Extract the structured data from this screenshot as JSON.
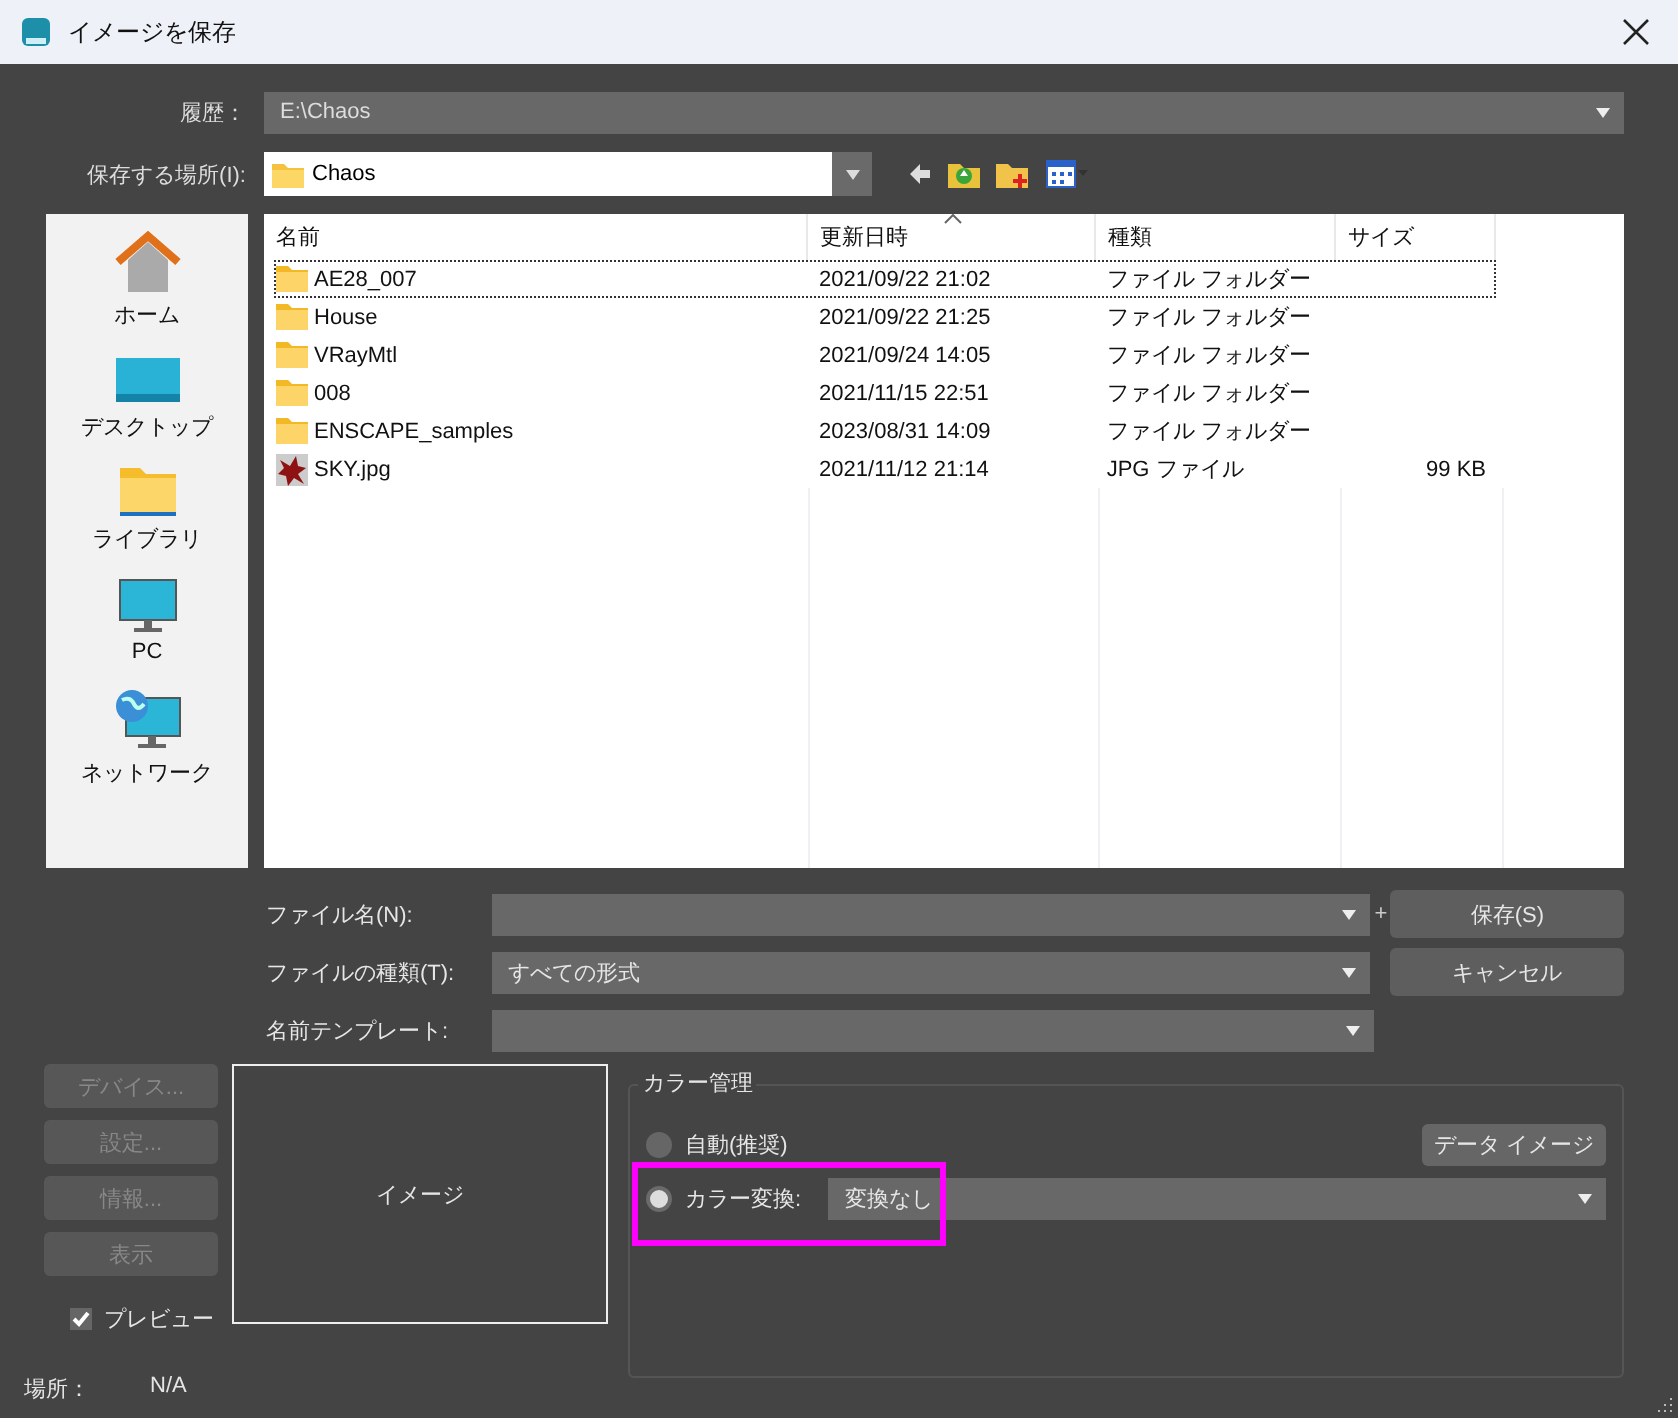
{
  "window": {
    "title": "イメージを保存"
  },
  "history": {
    "label": "履歴：",
    "value": "E:\\Chaos"
  },
  "save_in": {
    "label": "保存する場所(I):",
    "value": "Chaos"
  },
  "places": [
    {
      "label": "ホーム",
      "kind": "home"
    },
    {
      "label": "デスクトップ",
      "kind": "desktop"
    },
    {
      "label": "ライブラリ",
      "kind": "library"
    },
    {
      "label": "PC",
      "kind": "pc"
    },
    {
      "label": "ネットワーク",
      "kind": "network"
    }
  ],
  "file_list": {
    "columns": [
      {
        "label": "名前",
        "sorted": false
      },
      {
        "label": "更新日時",
        "sorted": true
      },
      {
        "label": "種類",
        "sorted": false
      },
      {
        "label": "サイズ",
        "sorted": false
      }
    ],
    "rows": [
      {
        "name": "AE28_007",
        "modified": "2021/09/22 21:02",
        "type": "ファイル フォルダー",
        "kind": "folder",
        "focused": true
      },
      {
        "name": "House",
        "modified": "2021/09/22 21:25",
        "type": "ファイル フォルダー",
        "kind": "folder",
        "focused": false
      },
      {
        "name": "VRayMtl",
        "modified": "2021/09/24 14:05",
        "type": "ファイル フォルダー",
        "kind": "folder",
        "focused": false
      },
      {
        "name": "008",
        "modified": "2021/11/15 22:51",
        "type": "ファイル フォルダー",
        "kind": "folder",
        "focused": false
      },
      {
        "name": "ENSCAPE_samples",
        "modified": "2023/08/31 14:09",
        "type": "ファイル フォルダー",
        "kind": "folder",
        "focused": false
      },
      {
        "name": "SKY.jpg",
        "modified": "2021/11/12 21:14",
        "type": "JPG ファイル",
        "size": "99 KB",
        "kind": "image",
        "focused": false
      }
    ]
  },
  "form": {
    "file_name": {
      "label": "ファイル名(N):"
    },
    "file_type": {
      "label": "ファイルの種類(T):",
      "value": "すべての形式"
    },
    "name_template": {
      "label": "名前テンプレート:"
    },
    "plus": "+"
  },
  "buttons": {
    "save": "保存(S)",
    "cancel": "キャンセル"
  },
  "device_buttons": [
    {
      "label": "デバイス...",
      "disabled": true
    },
    {
      "label": "設定...",
      "disabled": true
    },
    {
      "label": "情報...",
      "disabled": true
    },
    {
      "label": "表示",
      "disabled": true
    }
  ],
  "preview": {
    "label": "プレビュー",
    "checked": true
  },
  "location": {
    "label": "場所：",
    "value": "N/A"
  },
  "image_preview": {
    "label": "イメージ"
  },
  "color_management": {
    "title": "カラー管理",
    "options": [
      {
        "label": "自動(推奨)",
        "selected": false,
        "highlighted": false
      },
      {
        "label": "カラー変換:",
        "selected": true,
        "highlighted": true
      }
    ],
    "data_image_button": "データ イメージ",
    "conversion": {
      "value": "変換なし"
    }
  }
}
